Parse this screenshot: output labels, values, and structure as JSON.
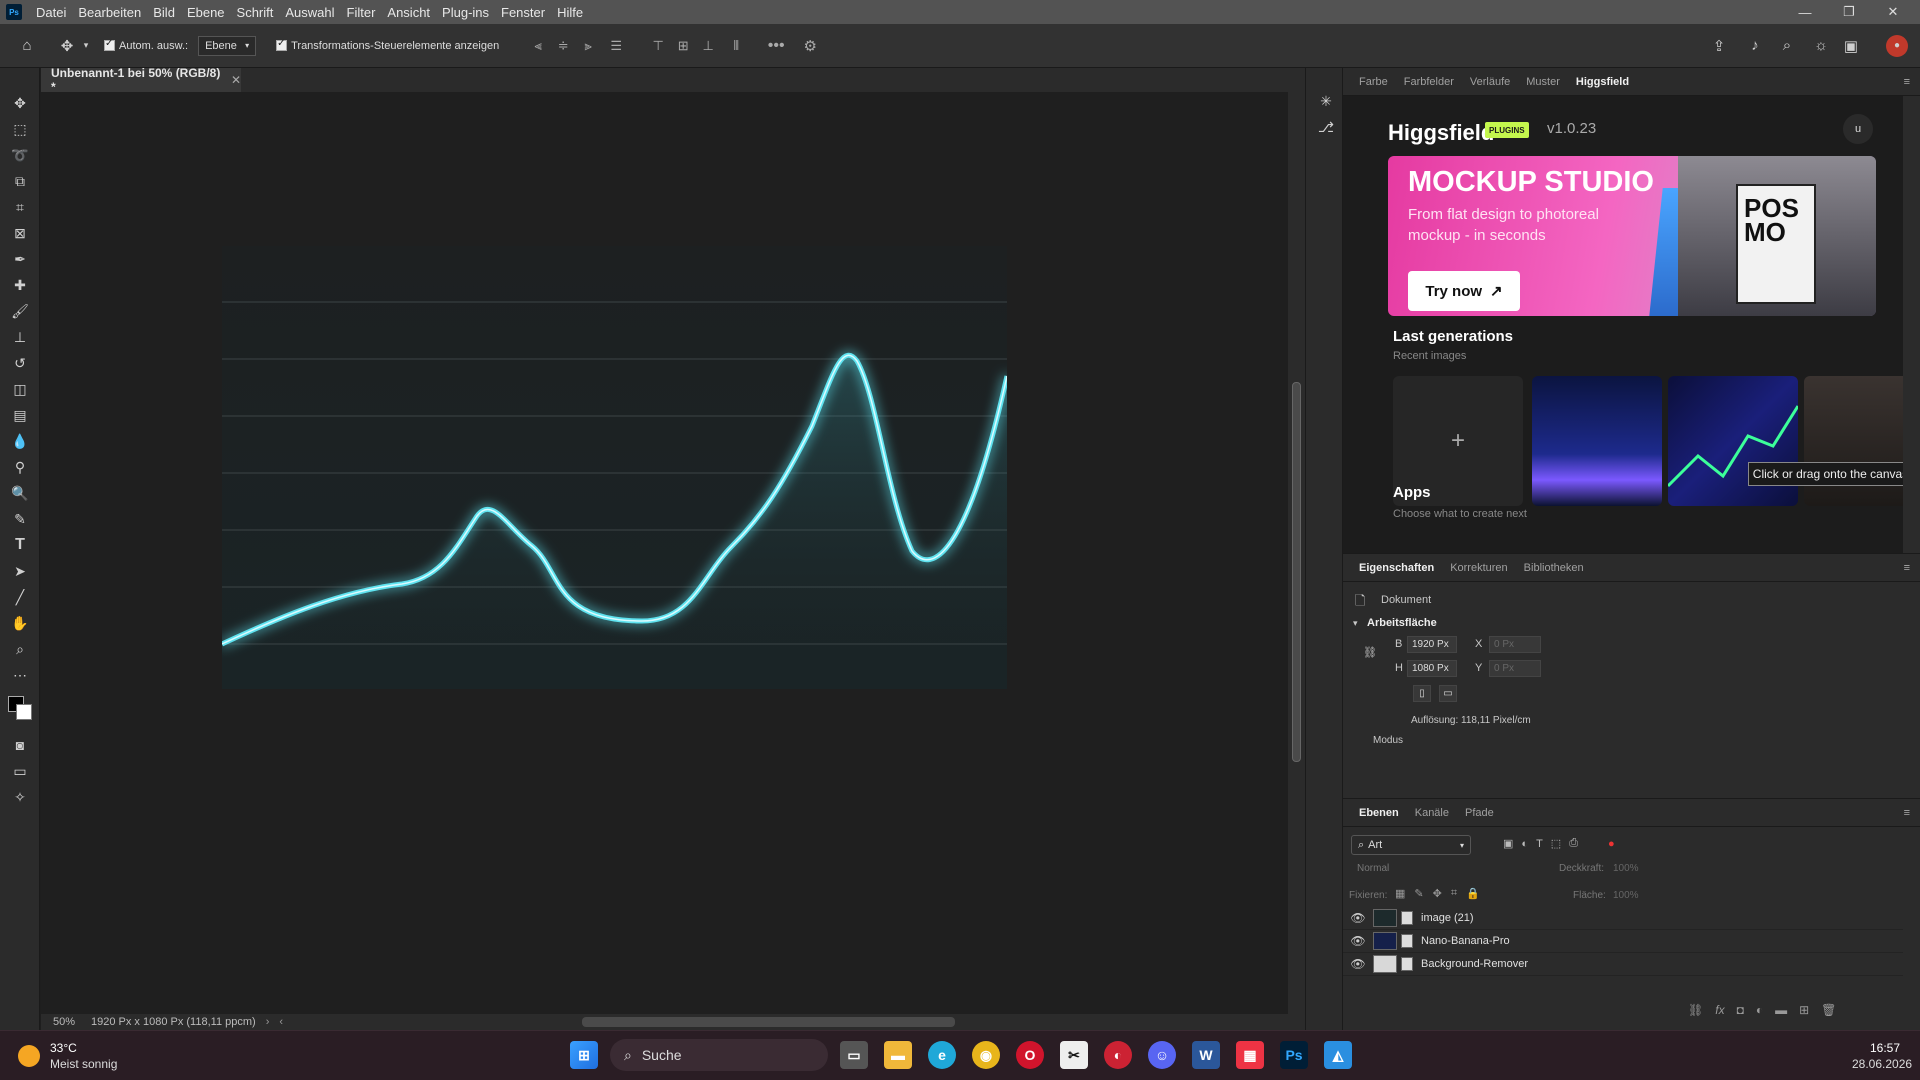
{
  "menubar": {
    "app_icon": "Ps",
    "items": [
      "Datei",
      "Bearbeiten",
      "Bild",
      "Ebene",
      "Schrift",
      "Auswahl",
      "Filter",
      "Ansicht",
      "Plug-ins",
      "Fenster",
      "Hilfe"
    ]
  },
  "options": {
    "auto_select_label": "Autom. ausw.:",
    "auto_select_target": "Ebene",
    "transform_controls_label": "Transformations-Steuerelemente anzeigen"
  },
  "document": {
    "tab_title": "Unbenannt-1 bei 50% (RGB/8) *",
    "zoom": "50%",
    "status": "1920 Px x 1080 Px (118,11 ppcm)"
  },
  "right_panel": {
    "tabs": [
      "Farbe",
      "Farbfelder",
      "Verläufe",
      "Muster",
      "Higgsfield"
    ],
    "active_tab": "Higgsfield"
  },
  "higgsfield": {
    "title": "Higgsfield",
    "badge": "PLUGINS",
    "version": "v1.0.23",
    "user_initial": "u",
    "banner": {
      "title": "MOCKUP STUDIO",
      "subtitle": "From flat design to photoreal mockup - in seconds",
      "cta": "Try now",
      "poster_text": "POS MO"
    },
    "last_generations_title": "Last generations",
    "last_generations_sub": "Recent images",
    "tooltip": "Click or drag onto the canvas",
    "apps_title": "Apps",
    "apps_sub": "Choose what to create next"
  },
  "properties": {
    "tabs": [
      "Eigenschaften",
      "Korrekturen",
      "Bibliotheken"
    ],
    "active_tab": "Eigenschaften",
    "doc_label": "Dokument",
    "section": "Arbeitsfläche",
    "width_label": "B",
    "width_value": "1920 Px",
    "height_label": "H",
    "height_value": "1080 Px",
    "x_label": "X",
    "x_value": "0 Px",
    "y_label": "Y",
    "y_value": "0 Px",
    "resolution": "Auflösung: 118,11 Pixel/cm",
    "mode_label": "Modus"
  },
  "layers": {
    "tabs": [
      "Ebenen",
      "Kanäle",
      "Pfade"
    ],
    "active_tab": "Ebenen",
    "filter_kind": "Art",
    "blend_mode": "Normal",
    "opacity_label": "Deckkraft:",
    "opacity_value": "100%",
    "lock_label": "Fixieren:",
    "fill_label": "Fläche:",
    "fill_value": "100%",
    "items": [
      {
        "name": "image (21)"
      },
      {
        "name": "Nano-Banana-Pro"
      },
      {
        "name": "Background-Remover"
      }
    ]
  },
  "taskbar": {
    "weather_temp": "33°C",
    "weather_desc": "Meist sonnig",
    "search_placeholder": "Suche",
    "time": "16:57",
    "date": "28.06.2026"
  },
  "colors": {
    "neon": "#5fe3f0",
    "accent_badge": "#c4f74d",
    "banner_pink": "#e53aa1"
  }
}
